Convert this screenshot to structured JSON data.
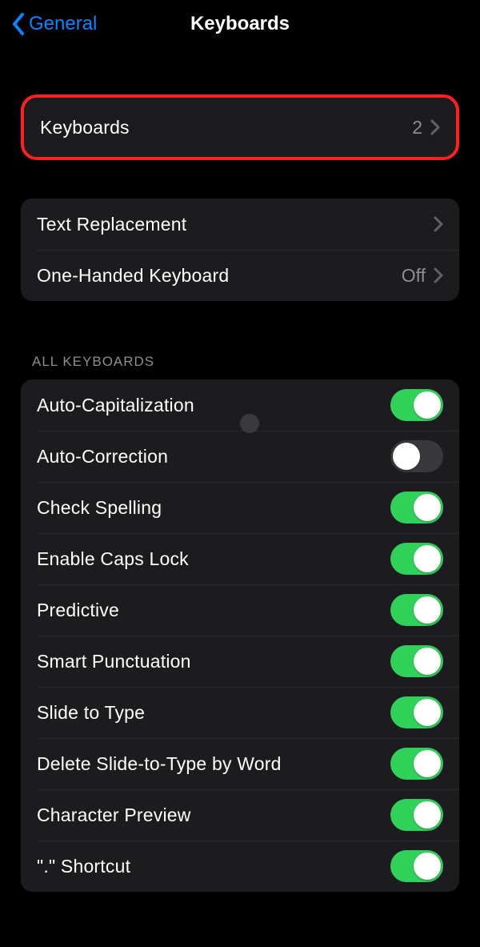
{
  "header": {
    "back_label": "General",
    "title": "Keyboards"
  },
  "group1": {
    "keyboards_label": "Keyboards",
    "keyboards_count": "2"
  },
  "group2": {
    "text_replacement_label": "Text Replacement",
    "one_handed_label": "One-Handed Keyboard",
    "one_handed_value": "Off"
  },
  "section_header": "ALL KEYBOARDS",
  "toggles": [
    {
      "label": "Auto-Capitalization",
      "on": true
    },
    {
      "label": "Auto-Correction",
      "on": false
    },
    {
      "label": "Check Spelling",
      "on": true
    },
    {
      "label": "Enable Caps Lock",
      "on": true
    },
    {
      "label": "Predictive",
      "on": true
    },
    {
      "label": "Smart Punctuation",
      "on": true
    },
    {
      "label": "Slide to Type",
      "on": true
    },
    {
      "label": "Delete Slide-to-Type by Word",
      "on": true
    },
    {
      "label": "Character Preview",
      "on": true
    },
    {
      "label": "\".\" Shortcut",
      "on": true
    }
  ]
}
